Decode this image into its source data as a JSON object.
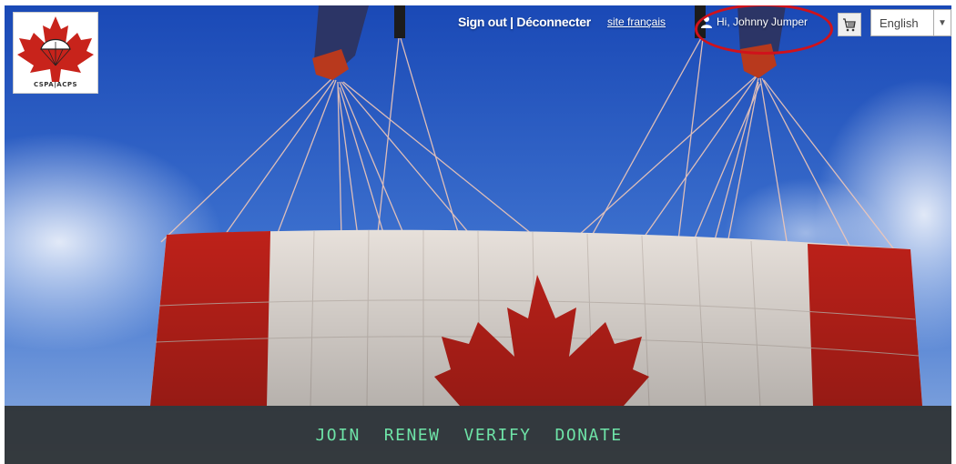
{
  "header": {
    "logo_text": "CSPA|ACPS",
    "signout_label": "Sign out | Déconnecter",
    "french_link": "site français",
    "user_greeting": "Hi, Johnny Jumper",
    "language": {
      "selected": "English"
    }
  },
  "nav": {
    "items": [
      {
        "label": "JOIN"
      },
      {
        "label": "RENEW"
      },
      {
        "label": "VERIFY"
      },
      {
        "label": "DONATE"
      }
    ]
  },
  "colors": {
    "nav_text": "#6ee3a7",
    "highlight_circle": "#d0121b",
    "flag_red": "#c8231b"
  }
}
